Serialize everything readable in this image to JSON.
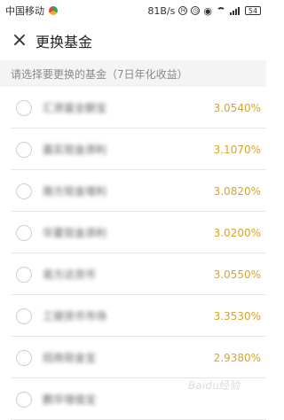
{
  "status_bar": {
    "carrier": "中国移动",
    "speed": "81B/s",
    "battery": "54"
  },
  "header": {
    "title": "更换基金"
  },
  "subtitle": "请选择要更换的基金（7日年化收益）",
  "funds": [
    {
      "name": "汇添富全额宝",
      "rate": "3.0540%"
    },
    {
      "name": "嘉实现金添利",
      "rate": "3.1070%"
    },
    {
      "name": "南方现金增利",
      "rate": "3.0820%"
    },
    {
      "name": "华夏现金添利",
      "rate": "3.0200%"
    },
    {
      "name": "易方达货币",
      "rate": "3.0550%"
    },
    {
      "name": "工银货币市场",
      "rate": "3.3530%"
    },
    {
      "name": "招商现金宝",
      "rate": "2.9380%"
    },
    {
      "name": "鹏华增值宝",
      "rate": ""
    }
  ],
  "watermark": "Baidu经验",
  "colors": {
    "rate": "#d9a52a",
    "subtitle_bg": "#f4f4f4",
    "divider": "#e7e7e7",
    "radio_border": "#cfcfcf"
  }
}
